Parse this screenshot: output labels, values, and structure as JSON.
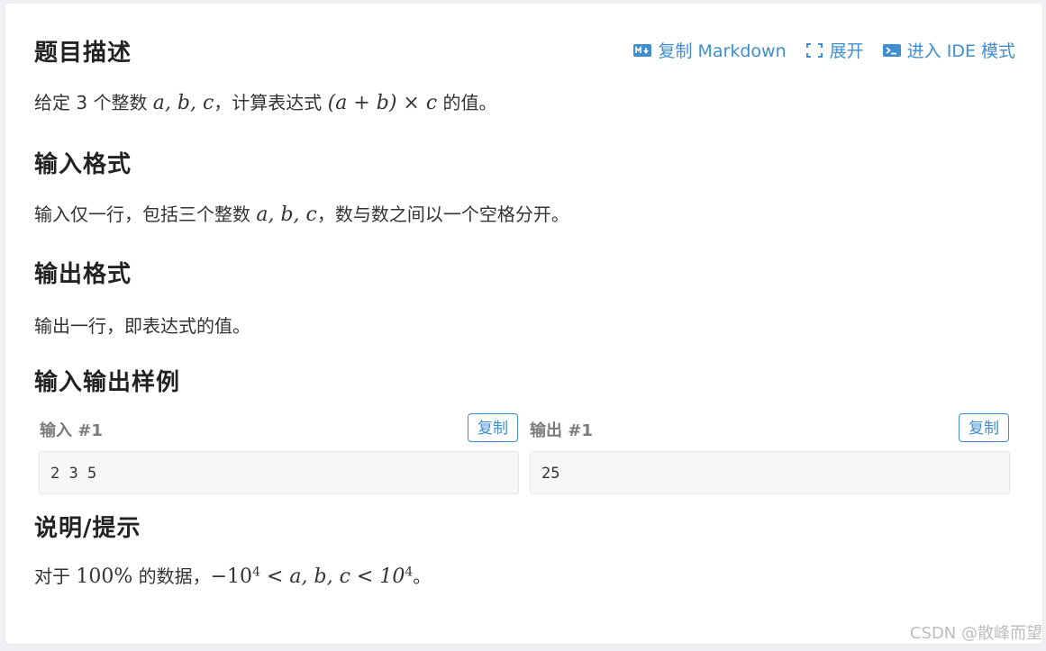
{
  "toolbar": {
    "copy_markdown": "复制 Markdown",
    "expand": "展开",
    "ide_mode": "进入 IDE 模式"
  },
  "sections": {
    "description": {
      "title": "题目描述",
      "text_before": "给定 3 个整数 ",
      "math1": "a, b, c",
      "text_mid": "，计算表达式 ",
      "math2": "(a + b) × c",
      "text_after": " 的值。"
    },
    "input_format": {
      "title": "输入格式",
      "text_before": "输入仅一行，包括三个整数 ",
      "math1": "a, b, c",
      "text_after": "，数与数之间以一个空格分开。"
    },
    "output_format": {
      "title": "输出格式",
      "text": "输出一行，即表达式的值。"
    },
    "samples": {
      "title": "输入输出样例",
      "input_label": "输入 #1",
      "output_label": "输出 #1",
      "copy_label": "复制",
      "input_value": "2 3 5",
      "output_value": "25"
    },
    "hint": {
      "title": "说明/提示",
      "text_before": "对于 ",
      "percent": "100%",
      "text_mid": " 的数据，",
      "math_neg": "−10",
      "exp1": "4",
      "math_mid": " < a, b, c < 10",
      "exp2": "4",
      "text_after": "。"
    }
  },
  "watermark": "CSDN @散峰而望",
  "colors": {
    "accent": "#3e8ed0",
    "background": "#eef0f3",
    "card": "#ffffff"
  }
}
